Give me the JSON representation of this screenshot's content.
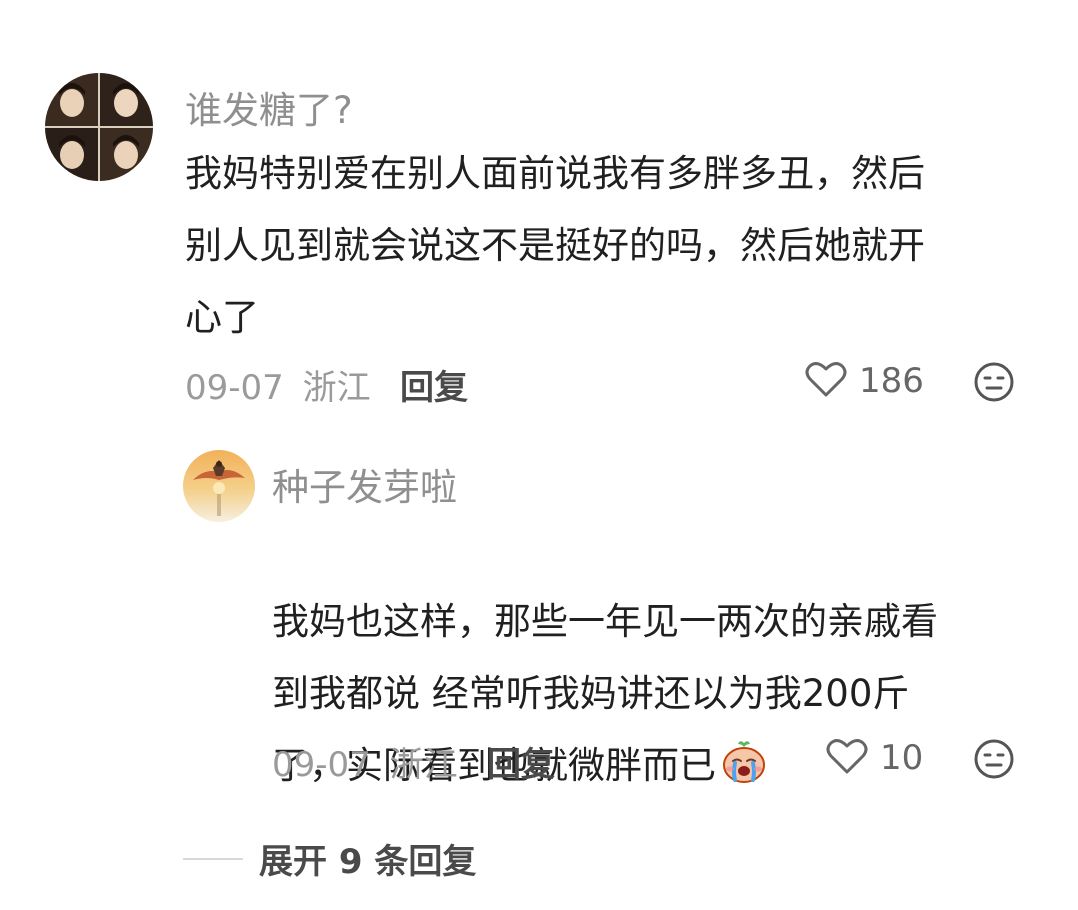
{
  "comment": {
    "username": "谁发糖了?",
    "text": "我妈特别爱在别人面前说我有多胖多丑，然后\n别人见到就会说这不是挺好的吗，然后她就开\n心了",
    "date": "09-07",
    "location": "浙江",
    "reply_label": "回复",
    "like_count": "186",
    "like_icon": "heart-outline-icon",
    "dislike_icon": "neutral-face-icon"
  },
  "reply": {
    "username": "种子发芽啦",
    "text": "我妈也这样，那些一年见一两次的亲戚看\n到我都说 经常听我妈讲还以为我200斤\n了，实际看到也就微胖而已",
    "emoji": "crying-emoji",
    "date": "09-07",
    "location": "浙江",
    "reply_label": "回复",
    "like_count": "10",
    "like_icon": "heart-outline-icon",
    "dislike_icon": "neutral-face-icon"
  },
  "expand": {
    "label": "展开 9 条回复"
  },
  "colors": {
    "username": "#8f8f8f",
    "body": "#202020",
    "meta": "#9a9a9a",
    "action": "#4a4a4a"
  }
}
